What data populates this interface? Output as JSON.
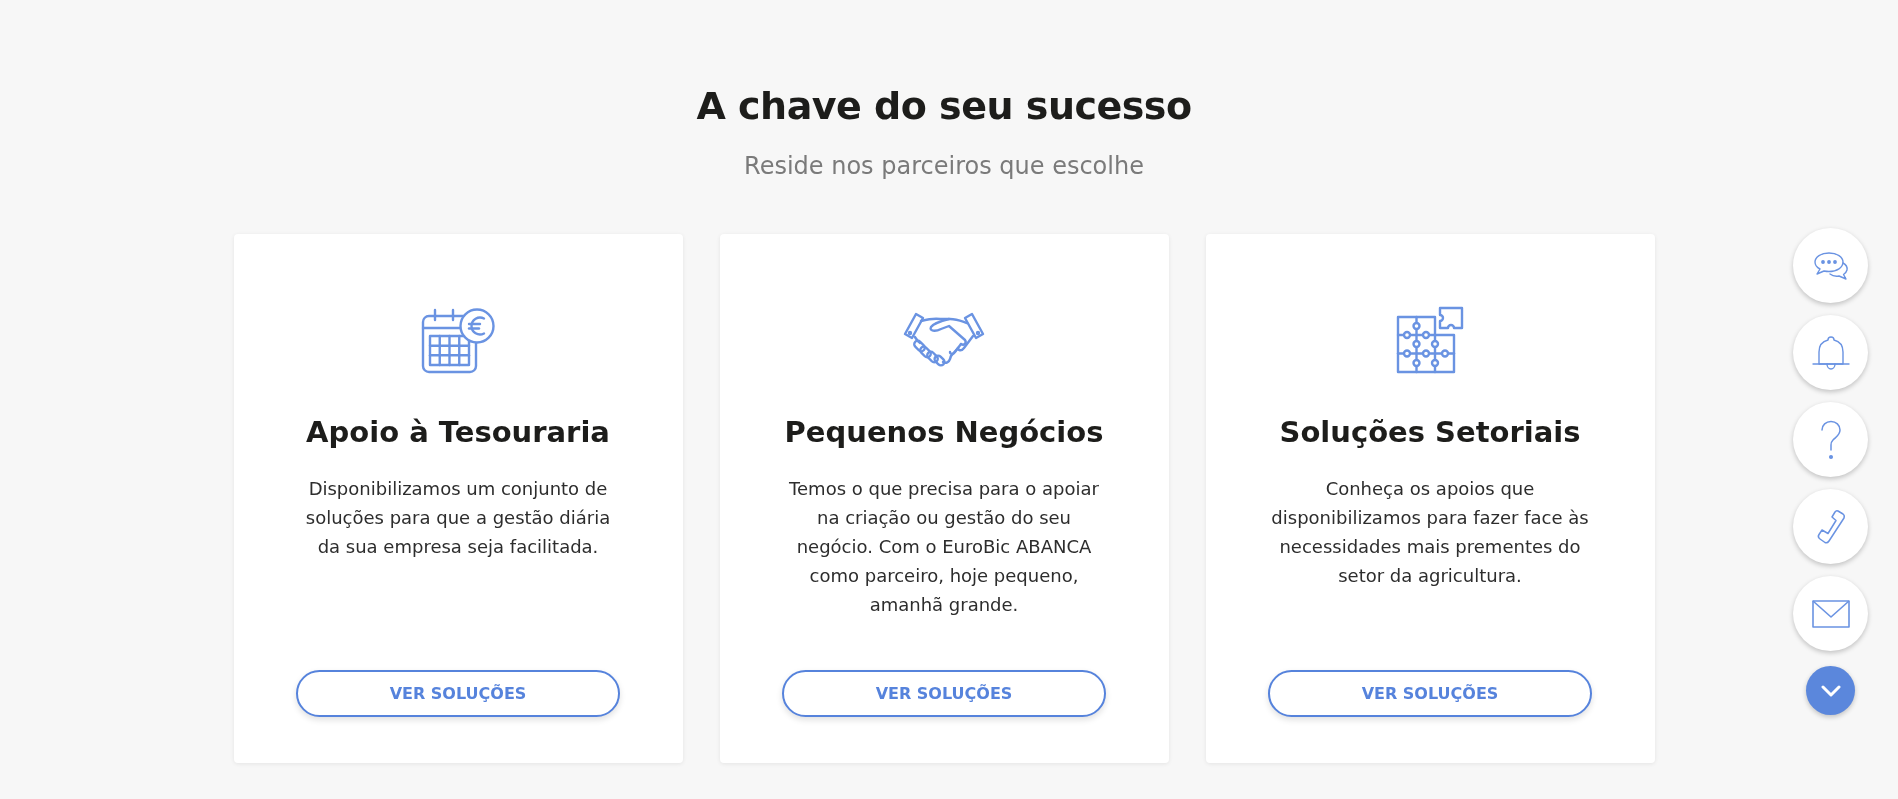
{
  "heading": {
    "title": "A chave do seu sucesso",
    "subtitle": "Reside nos parceiros que escolhe"
  },
  "cards": [
    {
      "title": "Apoio à Tesouraria",
      "description": "Disponibilizamos um conjunto de soluções para que a gestão diária da sua empresa seja facilitada.",
      "button": "VER SOLUÇÕES"
    },
    {
      "title": "Pequenos Negócios",
      "description": "Temos o que precisa para o apoiar na criação ou gestão do seu negócio. Com o EuroBic ABANCA como parceiro, hoje pequeno, amanhã grande.",
      "button": "VER SOLUÇÕES"
    },
    {
      "title": "Soluções Setoriais",
      "description": "Conheça os apoios que disponibilizamos para fazer face às necessidades mais prementes do setor da agricultura.",
      "button": "VER SOLUÇÕES"
    }
  ]
}
